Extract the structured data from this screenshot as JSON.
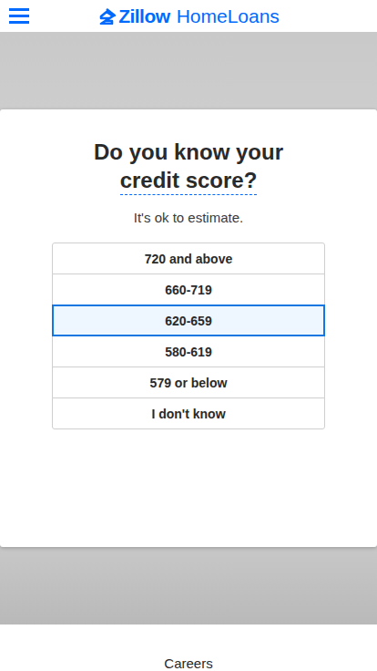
{
  "header": {
    "logo": {
      "brand": "Zillow",
      "product": "HomeLoans"
    }
  },
  "question": {
    "title": "Do you know your",
    "title_link": "credit score?",
    "subtitle": "It's ok to estimate."
  },
  "options": [
    {
      "label": "720 and above",
      "selected": false
    },
    {
      "label": "660-719",
      "selected": false
    },
    {
      "label": "620-659",
      "selected": true
    },
    {
      "label": "580-619",
      "selected": false
    },
    {
      "label": "579 or below",
      "selected": false
    },
    {
      "label": "I don't know",
      "selected": false
    }
  ],
  "footer": {
    "links": [
      "Careers"
    ]
  }
}
